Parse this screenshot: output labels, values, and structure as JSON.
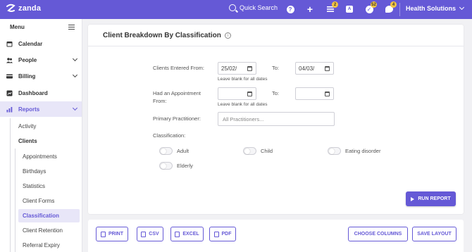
{
  "topbar": {
    "logo_text": "zanda",
    "search_label": "Quick Search",
    "queue_badge": "2",
    "tasks_badge": "52",
    "chat_badge": "4",
    "account_name": "Health Solutions"
  },
  "sidebar": {
    "menu_label": "Menu",
    "items": [
      {
        "label": "Calendar",
        "icon": "calendar-icon"
      },
      {
        "label": "People",
        "icon": "people-icon"
      },
      {
        "label": "Billing",
        "icon": "billing-icon"
      },
      {
        "label": "Dashboard",
        "icon": "dashboard-icon"
      },
      {
        "label": "Reports",
        "icon": "reports-icon"
      }
    ],
    "reports_sub": {
      "activity": "Activity",
      "clients": "Clients"
    },
    "clients_sub": [
      "Appointments",
      "Birthdays",
      "Statistics",
      "Client Forms",
      "Classification",
      "Client Retention",
      "Referral Expiry"
    ]
  },
  "report": {
    "title": "Client Breakdown By Classification",
    "entered_from_label": "Clients Entered From:",
    "entered_from_value": "25/02/",
    "to_label": "To:",
    "entered_to_value": "04/03/",
    "blank_hint": "Leave blank for all dates",
    "appointment_from_label_1": "Had an Appointment",
    "appointment_from_label_2": "From:",
    "appointment_to_label": "To:",
    "appointment_hint": "Leave blank for all dates",
    "practitioner_label": "Primary Practitioner:",
    "practitioner_placeholder": "All Practitioners...",
    "classification_label": "Classification:",
    "classifications": [
      "Adult",
      "Child",
      "Eating disorder",
      "Elderly"
    ],
    "run_label": "RUN REPORT"
  },
  "toolbar": {
    "print": "PRINT",
    "csv": "CSV",
    "excel": "EXCEL",
    "pdf": "PDF",
    "choose_columns": "CHOOSE COLUMNS",
    "save_layout": "SAVE LAYOUT"
  },
  "colors": {
    "brand": "#6559d6",
    "badge": "#f5c542",
    "active_bg": "#e8e6f8"
  }
}
